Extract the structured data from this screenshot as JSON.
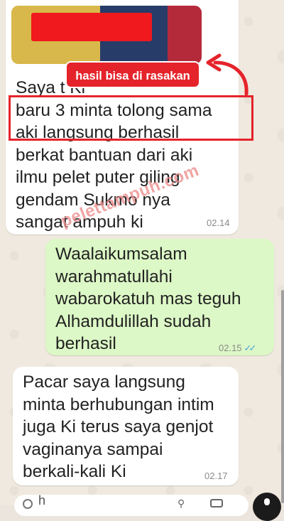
{
  "chat": {
    "messages": [
      {
        "direction": "in",
        "text": "Saya t                        Ki\nbaru 3 minta tolong sama\naki langsung berhasil\nberkat bantuan dari aki\nilmu pelet puter giling\ngendam Sukmo nya\nsangat ampuh ki",
        "time": "02.14"
      },
      {
        "direction": "out",
        "text": "Waalaikumsalam\nwarahmatullahi\nwabarokatuh mas teguh\nAlhamdulillah sudah\nberhasil",
        "time": "02.15",
        "status": "✓✓"
      },
      {
        "direction": "in",
        "text": "Pacar saya langsung\nminta berhubungan intim\njuga Ki terus saya genjot\nvaginanya sampai\nberkali-kali Ki",
        "time": "02.17"
      }
    ]
  },
  "annotation": {
    "label": "hasil bisa di rasakan",
    "color": "#e5232b"
  },
  "watermark": {
    "text": "pelettampuh.com"
  },
  "composer": {
    "text": "h",
    "icons": [
      "emoji-icon",
      "attach-icon",
      "camera-icon",
      "mic-icon"
    ]
  }
}
